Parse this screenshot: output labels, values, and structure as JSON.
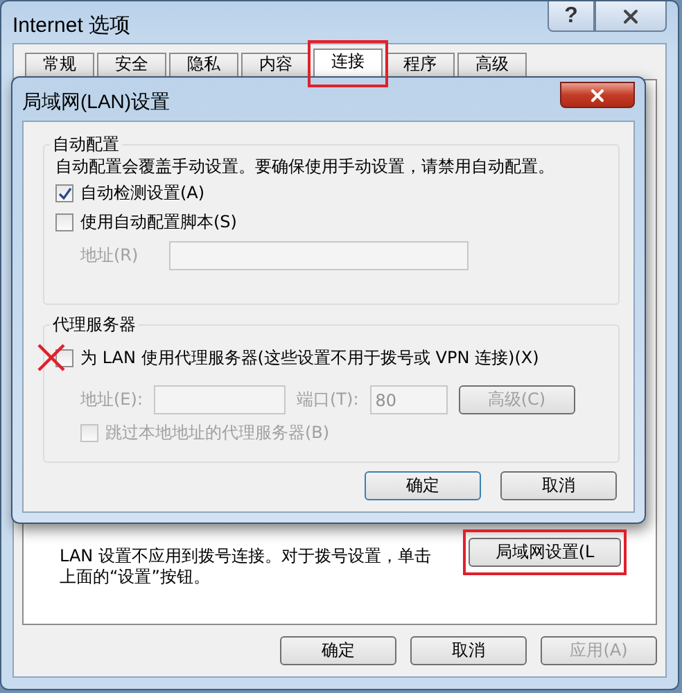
{
  "window": {
    "title": "Internet 选项",
    "help": "?"
  },
  "tabs": [
    {
      "label": "常规",
      "selected": false,
      "highlighted": false
    },
    {
      "label": "安全",
      "selected": false,
      "highlighted": false
    },
    {
      "label": "隐私",
      "selected": false,
      "highlighted": false
    },
    {
      "label": "内容",
      "selected": false,
      "highlighted": false
    },
    {
      "label": "连接",
      "selected": true,
      "highlighted": true
    },
    {
      "label": "程序",
      "selected": false,
      "highlighted": false
    },
    {
      "label": "高级",
      "selected": false,
      "highlighted": false
    }
  ],
  "lan_section": {
    "text": "LAN 设置不应用到拨号连接。对于拨号设置，单击上面的“设置”按钮。",
    "button": {
      "label": "局域网设置(L",
      "highlighted": true
    }
  },
  "buttons": [
    {
      "label": "确定",
      "disabled": false
    },
    {
      "label": "取消",
      "disabled": false
    },
    {
      "label": "应用(A)",
      "disabled": true
    }
  ],
  "dialog": {
    "title": "局域网(LAN)设置",
    "auto_config": {
      "legend": "自动配置",
      "description": "自动配置会覆盖手动设置。要确保使用手动设置，请禁用自动配置。",
      "options": [
        {
          "label": "自动检测设置(A)",
          "checked": true,
          "disabled": false
        },
        {
          "label": "使用自动配置脚本(S)",
          "checked": false,
          "disabled": false
        }
      ],
      "address": {
        "label": "地址(R)",
        "disabled": true
      }
    },
    "proxy": {
      "legend": "代理服务器",
      "use_proxy": {
        "label": "为 LAN 使用代理服务器(这些设置不用于拨号或 VPN 连接)(X)",
        "checked": false,
        "disabled": false,
        "marked": true
      },
      "address": {
        "label": "地址(E):",
        "disabled": true
      },
      "port": {
        "label": "端口(T):",
        "value": "80",
        "disabled": true
      },
      "advanced": {
        "label": "高级(C)",
        "disabled": true
      },
      "bypass": {
        "label": "跳过本地地址的代理服务器(B)",
        "checked": false,
        "disabled": true
      }
    },
    "buttons": [
      {
        "label": "确定",
        "default": true
      },
      {
        "label": "取消",
        "default": false
      }
    ]
  }
}
